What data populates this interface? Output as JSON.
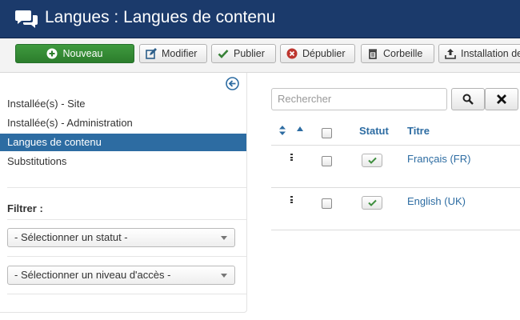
{
  "header": {
    "title": "Langues : Langues de contenu",
    "icon": "chat-bubbles-icon",
    "bg_color": "#1b3a6b"
  },
  "toolbar": {
    "new_label": "Nouveau",
    "edit_label": "Modifier",
    "publish_label": "Publier",
    "unpublish_label": "Dépublier",
    "trash_label": "Corbeille",
    "install_label": "Installation de"
  },
  "sidebar": {
    "items": [
      {
        "label": "Installée(s) - Site",
        "active": false
      },
      {
        "label": "Installée(s) - Administration",
        "active": false
      },
      {
        "label": "Langues de contenu",
        "active": true
      },
      {
        "label": "Substitutions",
        "active": false
      }
    ],
    "active_color": "#2d6ca2",
    "filter_label": "Filtrer :",
    "status_select": "- Sélectionner un statut -",
    "access_select": "- Sélectionner un niveau d'accès -"
  },
  "search": {
    "placeholder": "Rechercher"
  },
  "table": {
    "columns": {
      "status": "Statut",
      "title": "Titre"
    },
    "rows": [
      {
        "title": "Français (FR)",
        "published": true
      },
      {
        "title": "English (UK)",
        "published": true
      }
    ]
  }
}
